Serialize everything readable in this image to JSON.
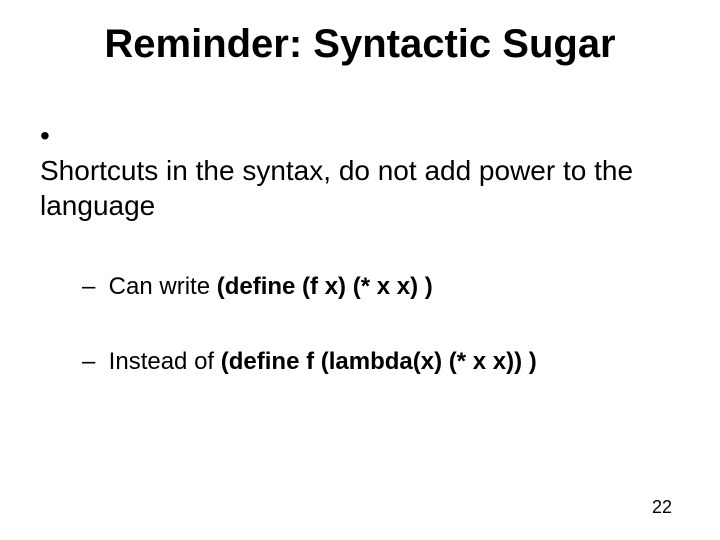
{
  "title": "Reminder: Syntactic Sugar",
  "bullets": {
    "main": "Shortcuts in the syntax, do not add power to the language",
    "sub1_prefix": "Can write ",
    "sub1_bold": "(define (f x) (* x x) )",
    "sub2_prefix": "Instead of ",
    "sub2_bold": "(define  f  (lambda(x) (* x x)) )"
  },
  "page_number": "22"
}
